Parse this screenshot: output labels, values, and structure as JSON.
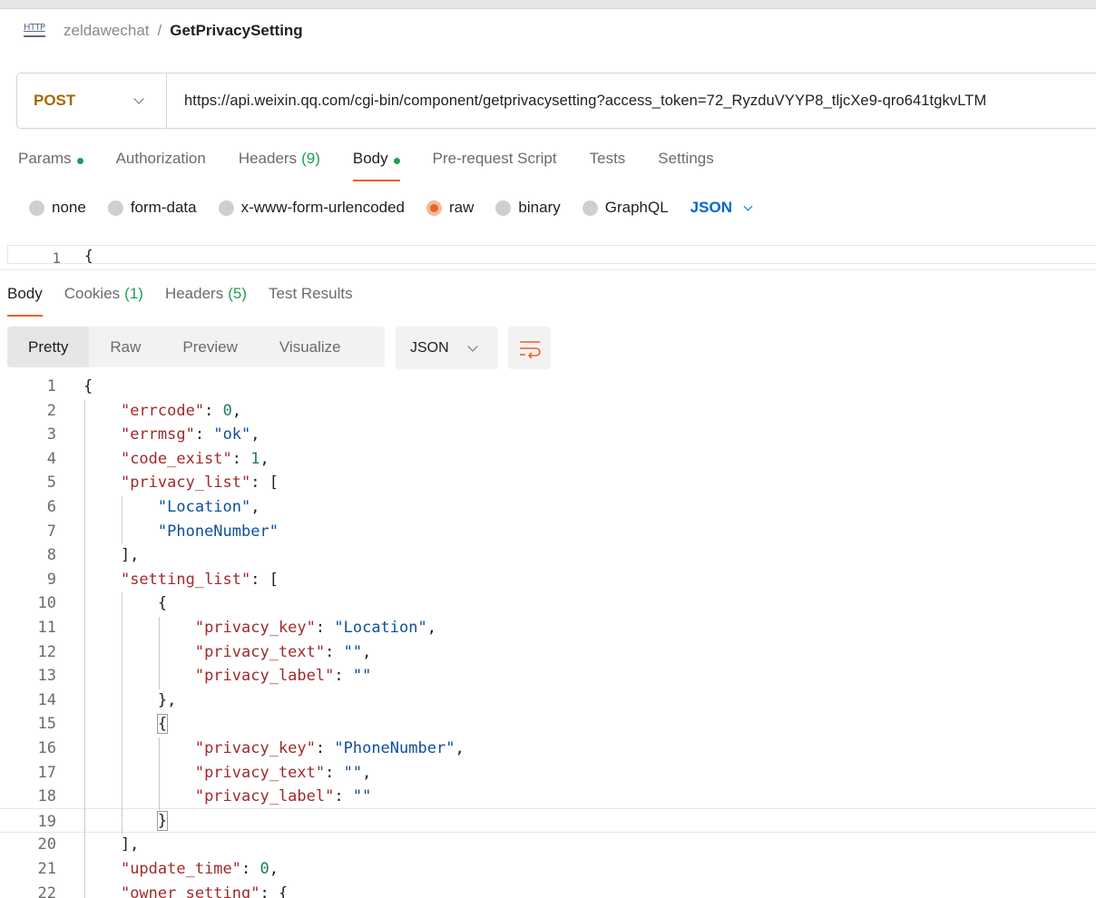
{
  "breadcrumb": {
    "icon": "http-icon",
    "icon_text": "HTTP",
    "parent": "zeldawechat",
    "separator": "/",
    "current": "GetPrivacySetting"
  },
  "request": {
    "method": "POST",
    "url": "https://api.weixin.qq.com/cgi-bin/component/getprivacysetting?access_token=72_RyzduVYYP8_tljcXe9-qro641tgkvLTM"
  },
  "request_tabs": [
    {
      "label": "Params",
      "dot": true,
      "count": ""
    },
    {
      "label": "Authorization",
      "dot": false,
      "count": ""
    },
    {
      "label": "Headers",
      "dot": false,
      "count": "(9)"
    },
    {
      "label": "Body",
      "dot": true,
      "count": "",
      "active": true
    },
    {
      "label": "Pre-request Script",
      "dot": false,
      "count": ""
    },
    {
      "label": "Tests",
      "dot": false,
      "count": ""
    },
    {
      "label": "Settings",
      "dot": false,
      "count": ""
    }
  ],
  "body_types": [
    {
      "label": "none",
      "selected": false
    },
    {
      "label": "form-data",
      "selected": false
    },
    {
      "label": "x-www-form-urlencoded",
      "selected": false
    },
    {
      "label": "raw",
      "selected": true
    },
    {
      "label": "binary",
      "selected": false
    },
    {
      "label": "GraphQL",
      "selected": false
    }
  ],
  "body_format": "JSON",
  "request_editor": {
    "line_number": "1",
    "text": "{"
  },
  "response_tabs": [
    {
      "label": "Body",
      "count": "",
      "active": true
    },
    {
      "label": "Cookies",
      "count": "(1)"
    },
    {
      "label": "Headers",
      "count": "(5)"
    },
    {
      "label": "Test Results",
      "count": ""
    }
  ],
  "view_modes": [
    "Pretty",
    "Raw",
    "Preview",
    "Visualize"
  ],
  "active_view": "Pretty",
  "response_format": "JSON",
  "colors": {
    "accent": "#e8622a",
    "method": "#a36a00",
    "status_green": "#1f9d55",
    "link_blue": "#0265d2",
    "json_key": "#a12a2a",
    "json_string": "#0b4f9c",
    "json_number": "#1f7a5c"
  },
  "response_lines": [
    [
      [
        "p",
        "{"
      ]
    ],
    [
      [
        "p",
        "    "
      ],
      [
        "k",
        "\"errcode\""
      ],
      [
        "p",
        ": "
      ],
      [
        "n",
        "0"
      ],
      [
        "p",
        ","
      ]
    ],
    [
      [
        "p",
        "    "
      ],
      [
        "k",
        "\"errmsg\""
      ],
      [
        "p",
        ": "
      ],
      [
        "s",
        "\"ok\""
      ],
      [
        "p",
        ","
      ]
    ],
    [
      [
        "p",
        "    "
      ],
      [
        "k",
        "\"code_exist\""
      ],
      [
        "p",
        ": "
      ],
      [
        "n",
        "1"
      ],
      [
        "p",
        ","
      ]
    ],
    [
      [
        "p",
        "    "
      ],
      [
        "k",
        "\"privacy_list\""
      ],
      [
        "p",
        ": ["
      ]
    ],
    [
      [
        "p",
        "        "
      ],
      [
        "s",
        "\"Location\""
      ],
      [
        "p",
        ","
      ]
    ],
    [
      [
        "p",
        "        "
      ],
      [
        "s",
        "\"PhoneNumber\""
      ]
    ],
    [
      [
        "p",
        "    ],"
      ]
    ],
    [
      [
        "p",
        "    "
      ],
      [
        "k",
        "\"setting_list\""
      ],
      [
        "p",
        ": ["
      ]
    ],
    [
      [
        "p",
        "        {"
      ]
    ],
    [
      [
        "p",
        "            "
      ],
      [
        "k",
        "\"privacy_key\""
      ],
      [
        "p",
        ": "
      ],
      [
        "s",
        "\"Location\""
      ],
      [
        "p",
        ","
      ]
    ],
    [
      [
        "p",
        "            "
      ],
      [
        "k",
        "\"privacy_text\""
      ],
      [
        "p",
        ": "
      ],
      [
        "s",
        "\"\""
      ],
      [
        "p",
        ","
      ]
    ],
    [
      [
        "p",
        "            "
      ],
      [
        "k",
        "\"privacy_label\""
      ],
      [
        "p",
        ": "
      ],
      [
        "s",
        "\"\""
      ]
    ],
    [
      [
        "p",
        "        },"
      ]
    ],
    [
      [
        "p",
        "        "
      ],
      [
        "b",
        "{"
      ]
    ],
    [
      [
        "p",
        "            "
      ],
      [
        "k",
        "\"privacy_key\""
      ],
      [
        "p",
        ": "
      ],
      [
        "s",
        "\"PhoneNumber\""
      ],
      [
        "p",
        ","
      ]
    ],
    [
      [
        "p",
        "            "
      ],
      [
        "k",
        "\"privacy_text\""
      ],
      [
        "p",
        ": "
      ],
      [
        "s",
        "\"\""
      ],
      [
        "p",
        ","
      ]
    ],
    [
      [
        "p",
        "            "
      ],
      [
        "k",
        "\"privacy_label\""
      ],
      [
        "p",
        ": "
      ],
      [
        "s",
        "\"\""
      ]
    ],
    [
      [
        "p",
        "        "
      ],
      [
        "b",
        "}"
      ]
    ],
    [
      [
        "p",
        "    ],"
      ]
    ],
    [
      [
        "p",
        "    "
      ],
      [
        "k",
        "\"update_time\""
      ],
      [
        "p",
        ": "
      ],
      [
        "n",
        "0"
      ],
      [
        "p",
        ","
      ]
    ],
    [
      [
        "p",
        "    "
      ],
      [
        "k",
        "\"owner_setting\""
      ],
      [
        "p",
        ": {"
      ]
    ]
  ],
  "highlighted_line": 19
}
